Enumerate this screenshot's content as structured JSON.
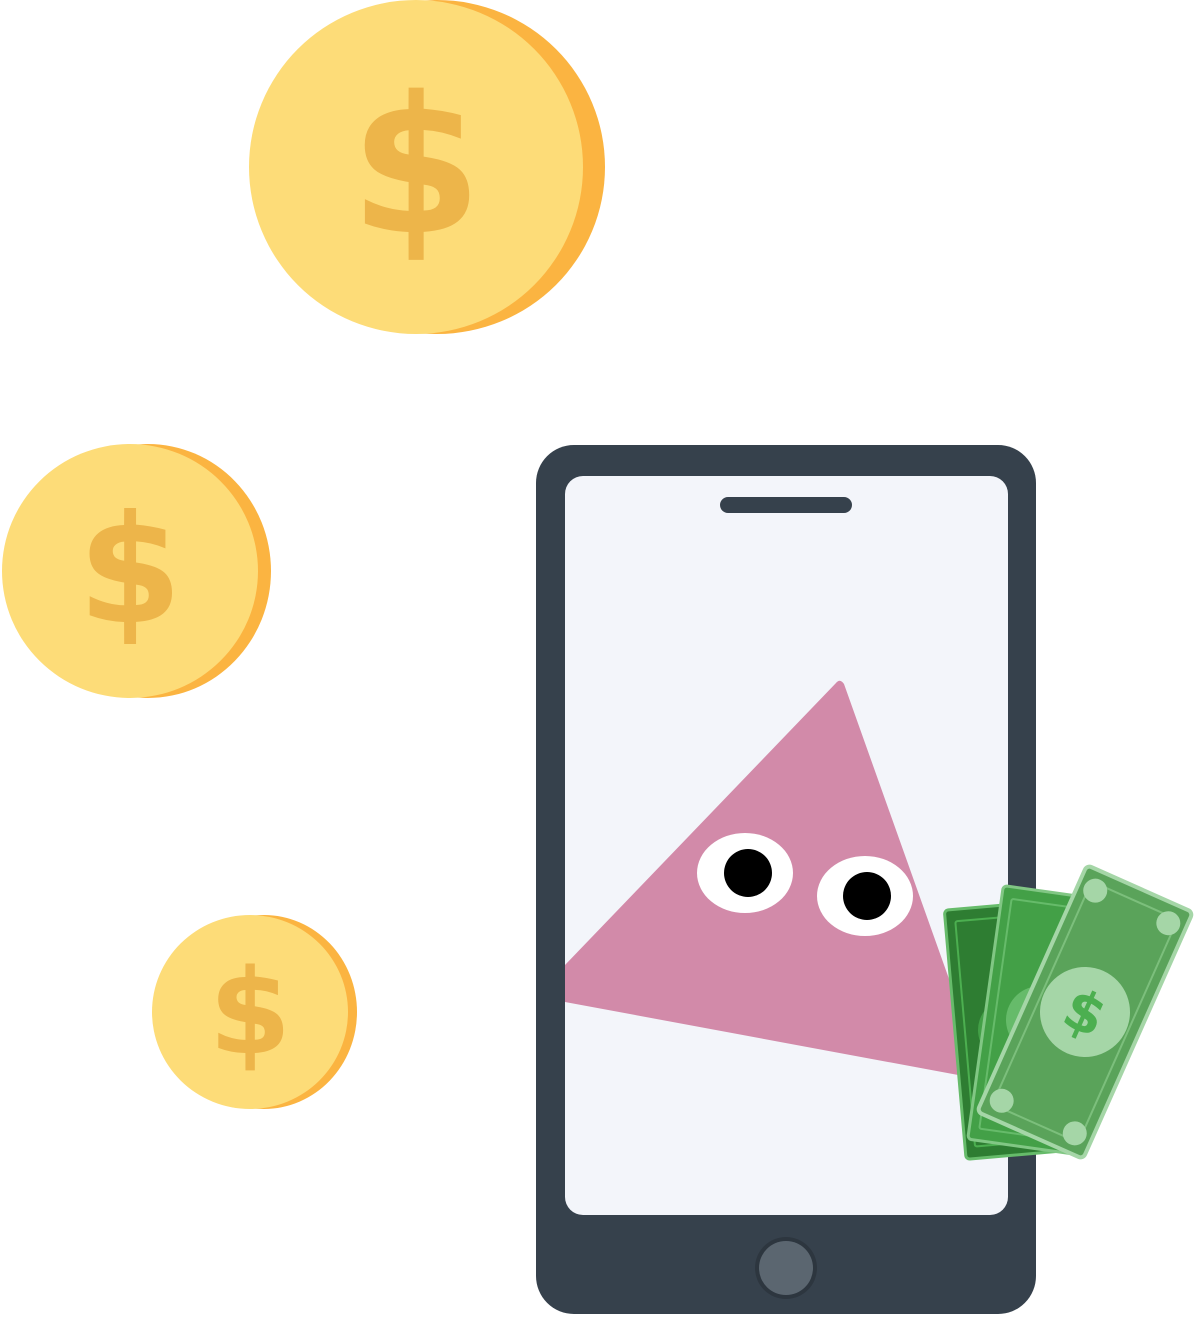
{
  "illustration": {
    "coins": [
      {
        "symbol": "$"
      },
      {
        "symbol": "$"
      },
      {
        "symbol": "$"
      }
    ],
    "bills": [
      {
        "symbol": "$"
      },
      {
        "symbol": "$"
      },
      {
        "symbol": "$"
      }
    ],
    "icons": [
      "coin-icon",
      "smartphone-icon",
      "cash-bill-icon",
      "pink-triangle-character-icon",
      "home-button-icon",
      "speaker-slot-icon"
    ],
    "colors": {
      "coin_face": "#FDDC78",
      "coin_edge": "#FBB441",
      "coin_symbol": "#EDB54A",
      "coin_symbol_shade": "#E8A93A",
      "phone_body": "#36414C",
      "phone_screen": "#F3F5FA",
      "phone_button": "#5B6670",
      "character": "#D28AA9",
      "eye_white": "#FFFFFF",
      "pupil": "#000000",
      "bill_dark": "#2E7D32",
      "bill_mid": "#43A047",
      "bill_light": "#5AA35A",
      "bill_medallion": "#A5D6A7",
      "bill_symbol": "#4CAF50"
    }
  }
}
